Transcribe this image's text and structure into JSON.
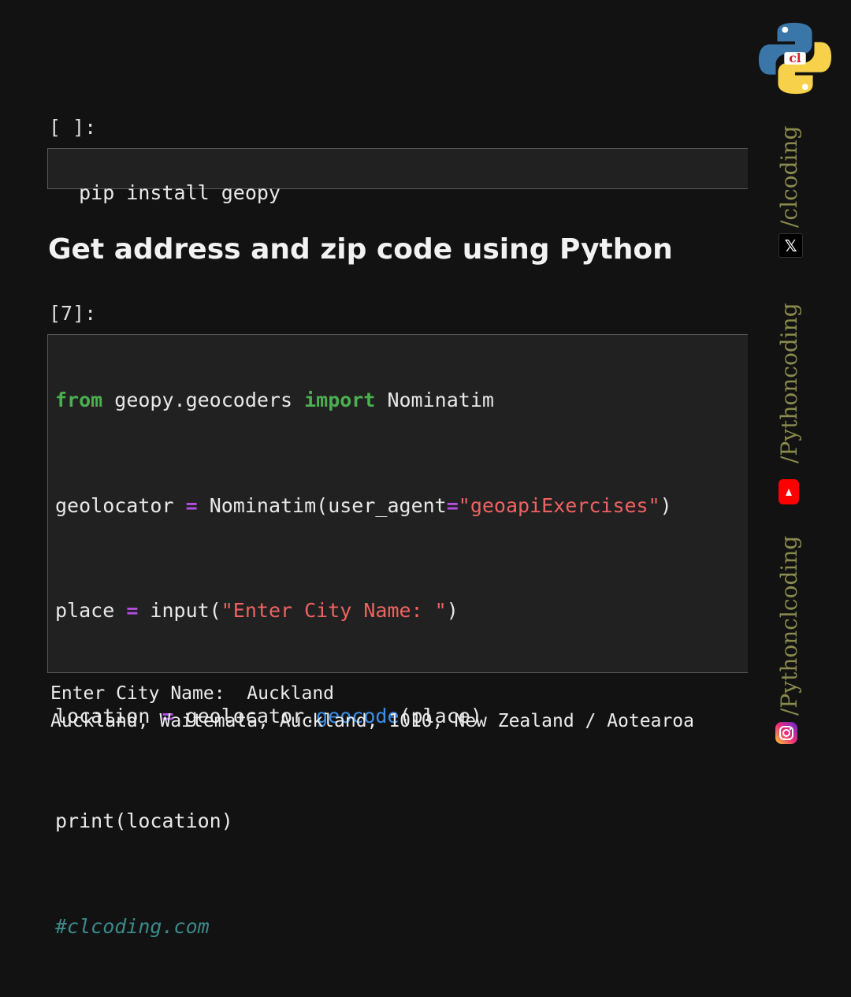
{
  "cells": [
    {
      "prompt": "[ ]:",
      "lines": [
        [
          "pip install geopy"
        ]
      ]
    },
    {
      "prompt": "[7]:",
      "lines": [
        [
          "from",
          " geopy.geocoders ",
          "import",
          " Nominatim"
        ],
        [
          "geolocator ",
          "=",
          " Nominatim(user_agent",
          "=",
          "\"geoapiExercises\"",
          ")"
        ],
        [
          "place ",
          "=",
          " input(",
          "\"Enter City Name: \"",
          ")"
        ],
        [
          "location ",
          "=",
          " geolocator.",
          "geocode",
          "(place)"
        ],
        [
          "print(location)"
        ],
        [
          "#clcoding.com"
        ]
      ]
    }
  ],
  "heading": "Get address and zip code using Python",
  "output": {
    "line1": "Enter City Name:  Auckland",
    "line2": "Auckland, Waitematā, Auckland, 1010, New Zealand / Aotearoa"
  },
  "sidebar": {
    "handle_x": "/clcoding",
    "handle_youtube": "/Pythoncoding",
    "handle_instagram": "/Pythonclcoding",
    "x_icon_glyph": "𝕏",
    "icons": [
      "python-logo",
      "x-icon",
      "youtube-icon",
      "instagram-icon"
    ]
  },
  "colors": {
    "background": "#121212",
    "cell_background": "#212121",
    "keyword": "#4caf50",
    "operator": "#b54ee0",
    "string": "#ef6262",
    "function": "#3c8ee8",
    "comment": "#3c8a8c",
    "sidebar_text": "#8a8a4e"
  }
}
